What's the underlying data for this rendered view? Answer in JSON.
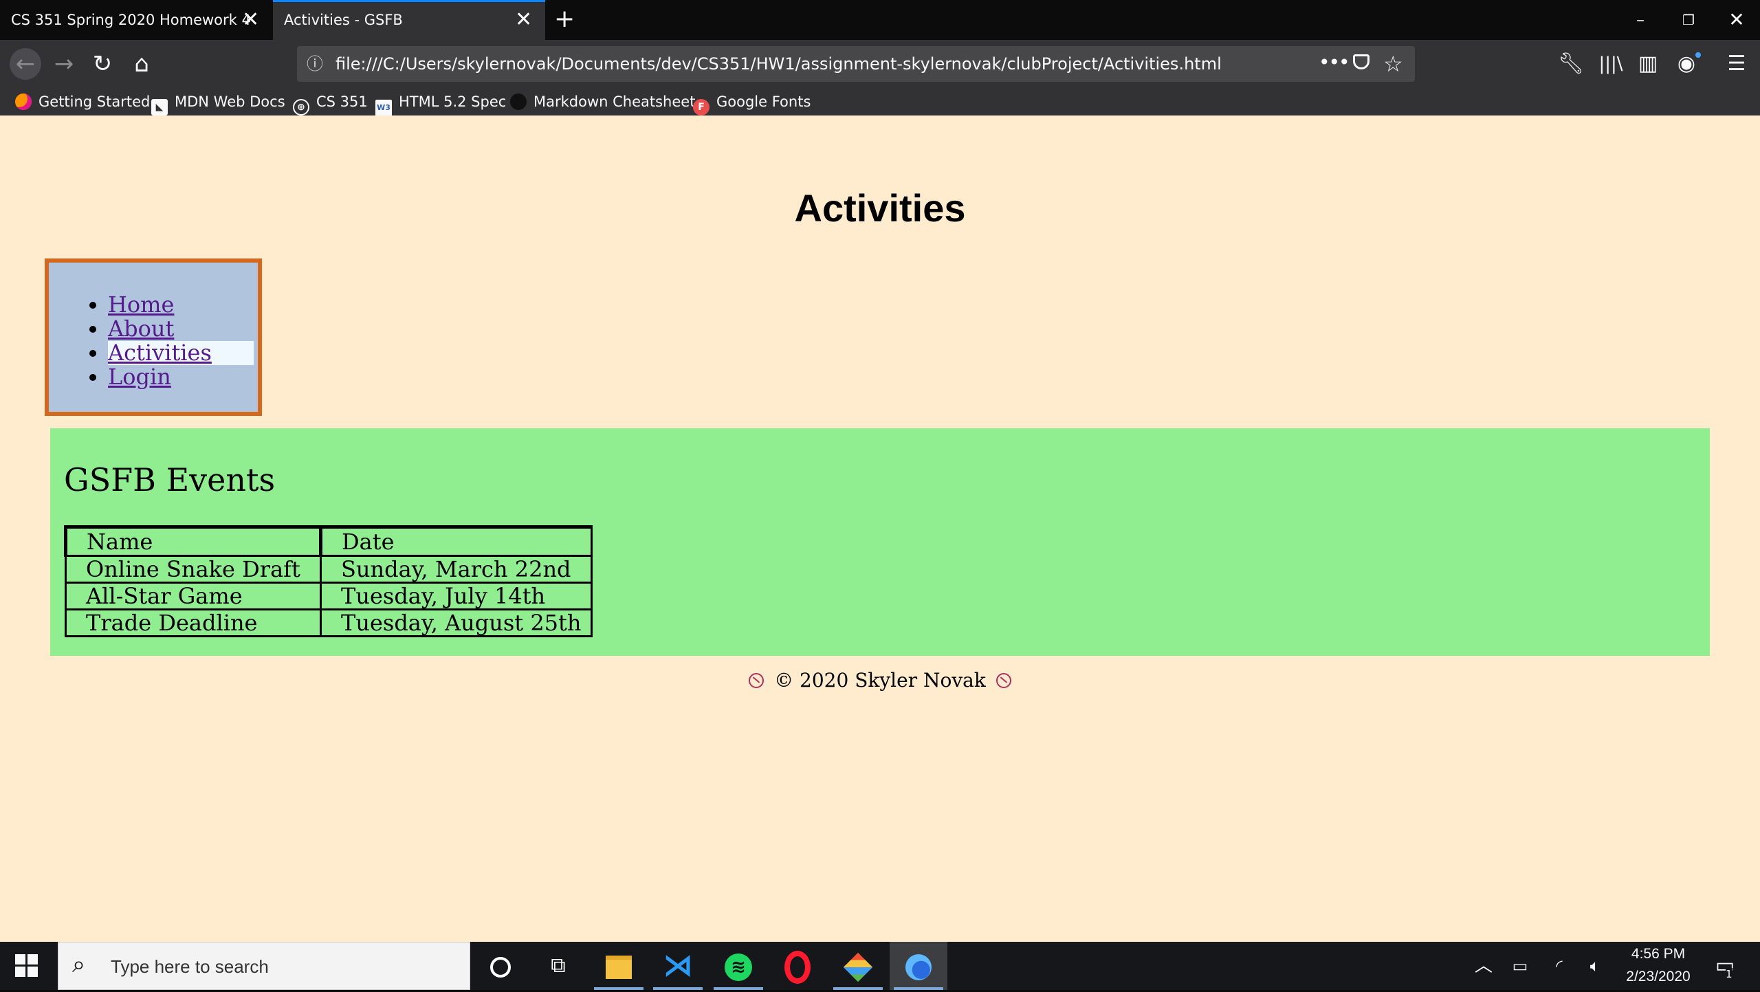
{
  "browser": {
    "tabs": [
      {
        "title": "CS 351 Spring 2020 Homework 4",
        "active": false
      },
      {
        "title": "Activities - GSFB",
        "active": true
      }
    ],
    "new_tab_symbol": "+",
    "url": "file:///C:/Users/skylernovak/Documents/dev/CS351/HW1/assignment-skylernovak/clubProject/Activities.html",
    "bookmarks": [
      {
        "label": "Getting Started",
        "icon": "firefox-icon"
      },
      {
        "label": "MDN Web Docs",
        "icon": "mdn-icon"
      },
      {
        "label": "CS 351",
        "icon": "globe-icon"
      },
      {
        "label": "HTML 5.2 Spec",
        "icon": "w3c-icon"
      },
      {
        "label": "Markdown Cheatsheet",
        "icon": "github-icon"
      },
      {
        "label": "Google Fonts",
        "icon": "google-fonts-icon"
      }
    ],
    "accent_color": "#0a84ff"
  },
  "page": {
    "title": "Activities",
    "nav": {
      "items": [
        "Home",
        "About",
        "Activities",
        "Login"
      ],
      "current": "Activities"
    },
    "section_title": "GSFB Events",
    "table": {
      "headers": [
        "Name",
        "Date"
      ],
      "rows": [
        [
          "Online Snake Draft",
          "Sunday, March 22nd"
        ],
        [
          "All-Star Game",
          "Tuesday, July 14th"
        ],
        [
          "Trade Deadline",
          "Tuesday, August 25th"
        ]
      ]
    },
    "footer": "© 2020 Skyler Novak",
    "colors": {
      "background": "#ffebcd",
      "nav_background": "#b0c4de",
      "nav_border": "#d2691e",
      "content_background": "#90ee90"
    }
  },
  "taskbar": {
    "search_placeholder": "Type here to search",
    "apps": [
      "cortana",
      "task-view",
      "file-explorer",
      "vscode",
      "spotify",
      "opera",
      "git",
      "firefox"
    ],
    "time": "4:56 PM",
    "date": "2/23/2020",
    "notification_count": "1"
  }
}
